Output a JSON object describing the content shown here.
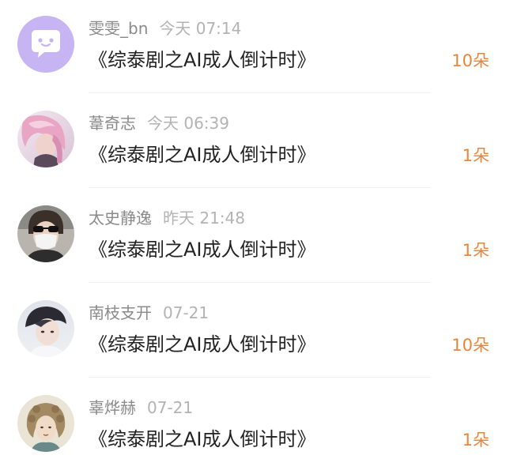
{
  "colors": {
    "accent_count": "#e8853a",
    "name_gray": "#8a8a8a",
    "time_gray": "#b3b3b3",
    "title_dark": "#222222"
  },
  "items": [
    {
      "name": "雯雯_bn",
      "time": "今天 07:14",
      "title": "《综泰剧之AI成人倒计时》",
      "count": "10朵",
      "avatar_icon": "chat-bubble-avatar-icon"
    },
    {
      "name": "葦奇志",
      "time": "今天 06:39",
      "title": "《综泰剧之AI成人倒计时》",
      "count": "1朵",
      "avatar_icon": "pink-hair-avatar-image"
    },
    {
      "name": "太史静逸",
      "time": "昨天 21:48",
      "title": "《综泰剧之AI成人倒计时》",
      "count": "1朵",
      "avatar_icon": "masked-person-avatar-image"
    },
    {
      "name": "南枝支开",
      "time": "07-21",
      "title": "《综泰剧之AI成人倒计时》",
      "count": "10朵",
      "avatar_icon": "anime-boy-avatar-image"
    },
    {
      "name": "辜烨赫",
      "time": "07-21",
      "title": "《综泰剧之AI成人倒计时》",
      "count": "1朵",
      "avatar_icon": "vintage-lady-avatar-image"
    }
  ]
}
